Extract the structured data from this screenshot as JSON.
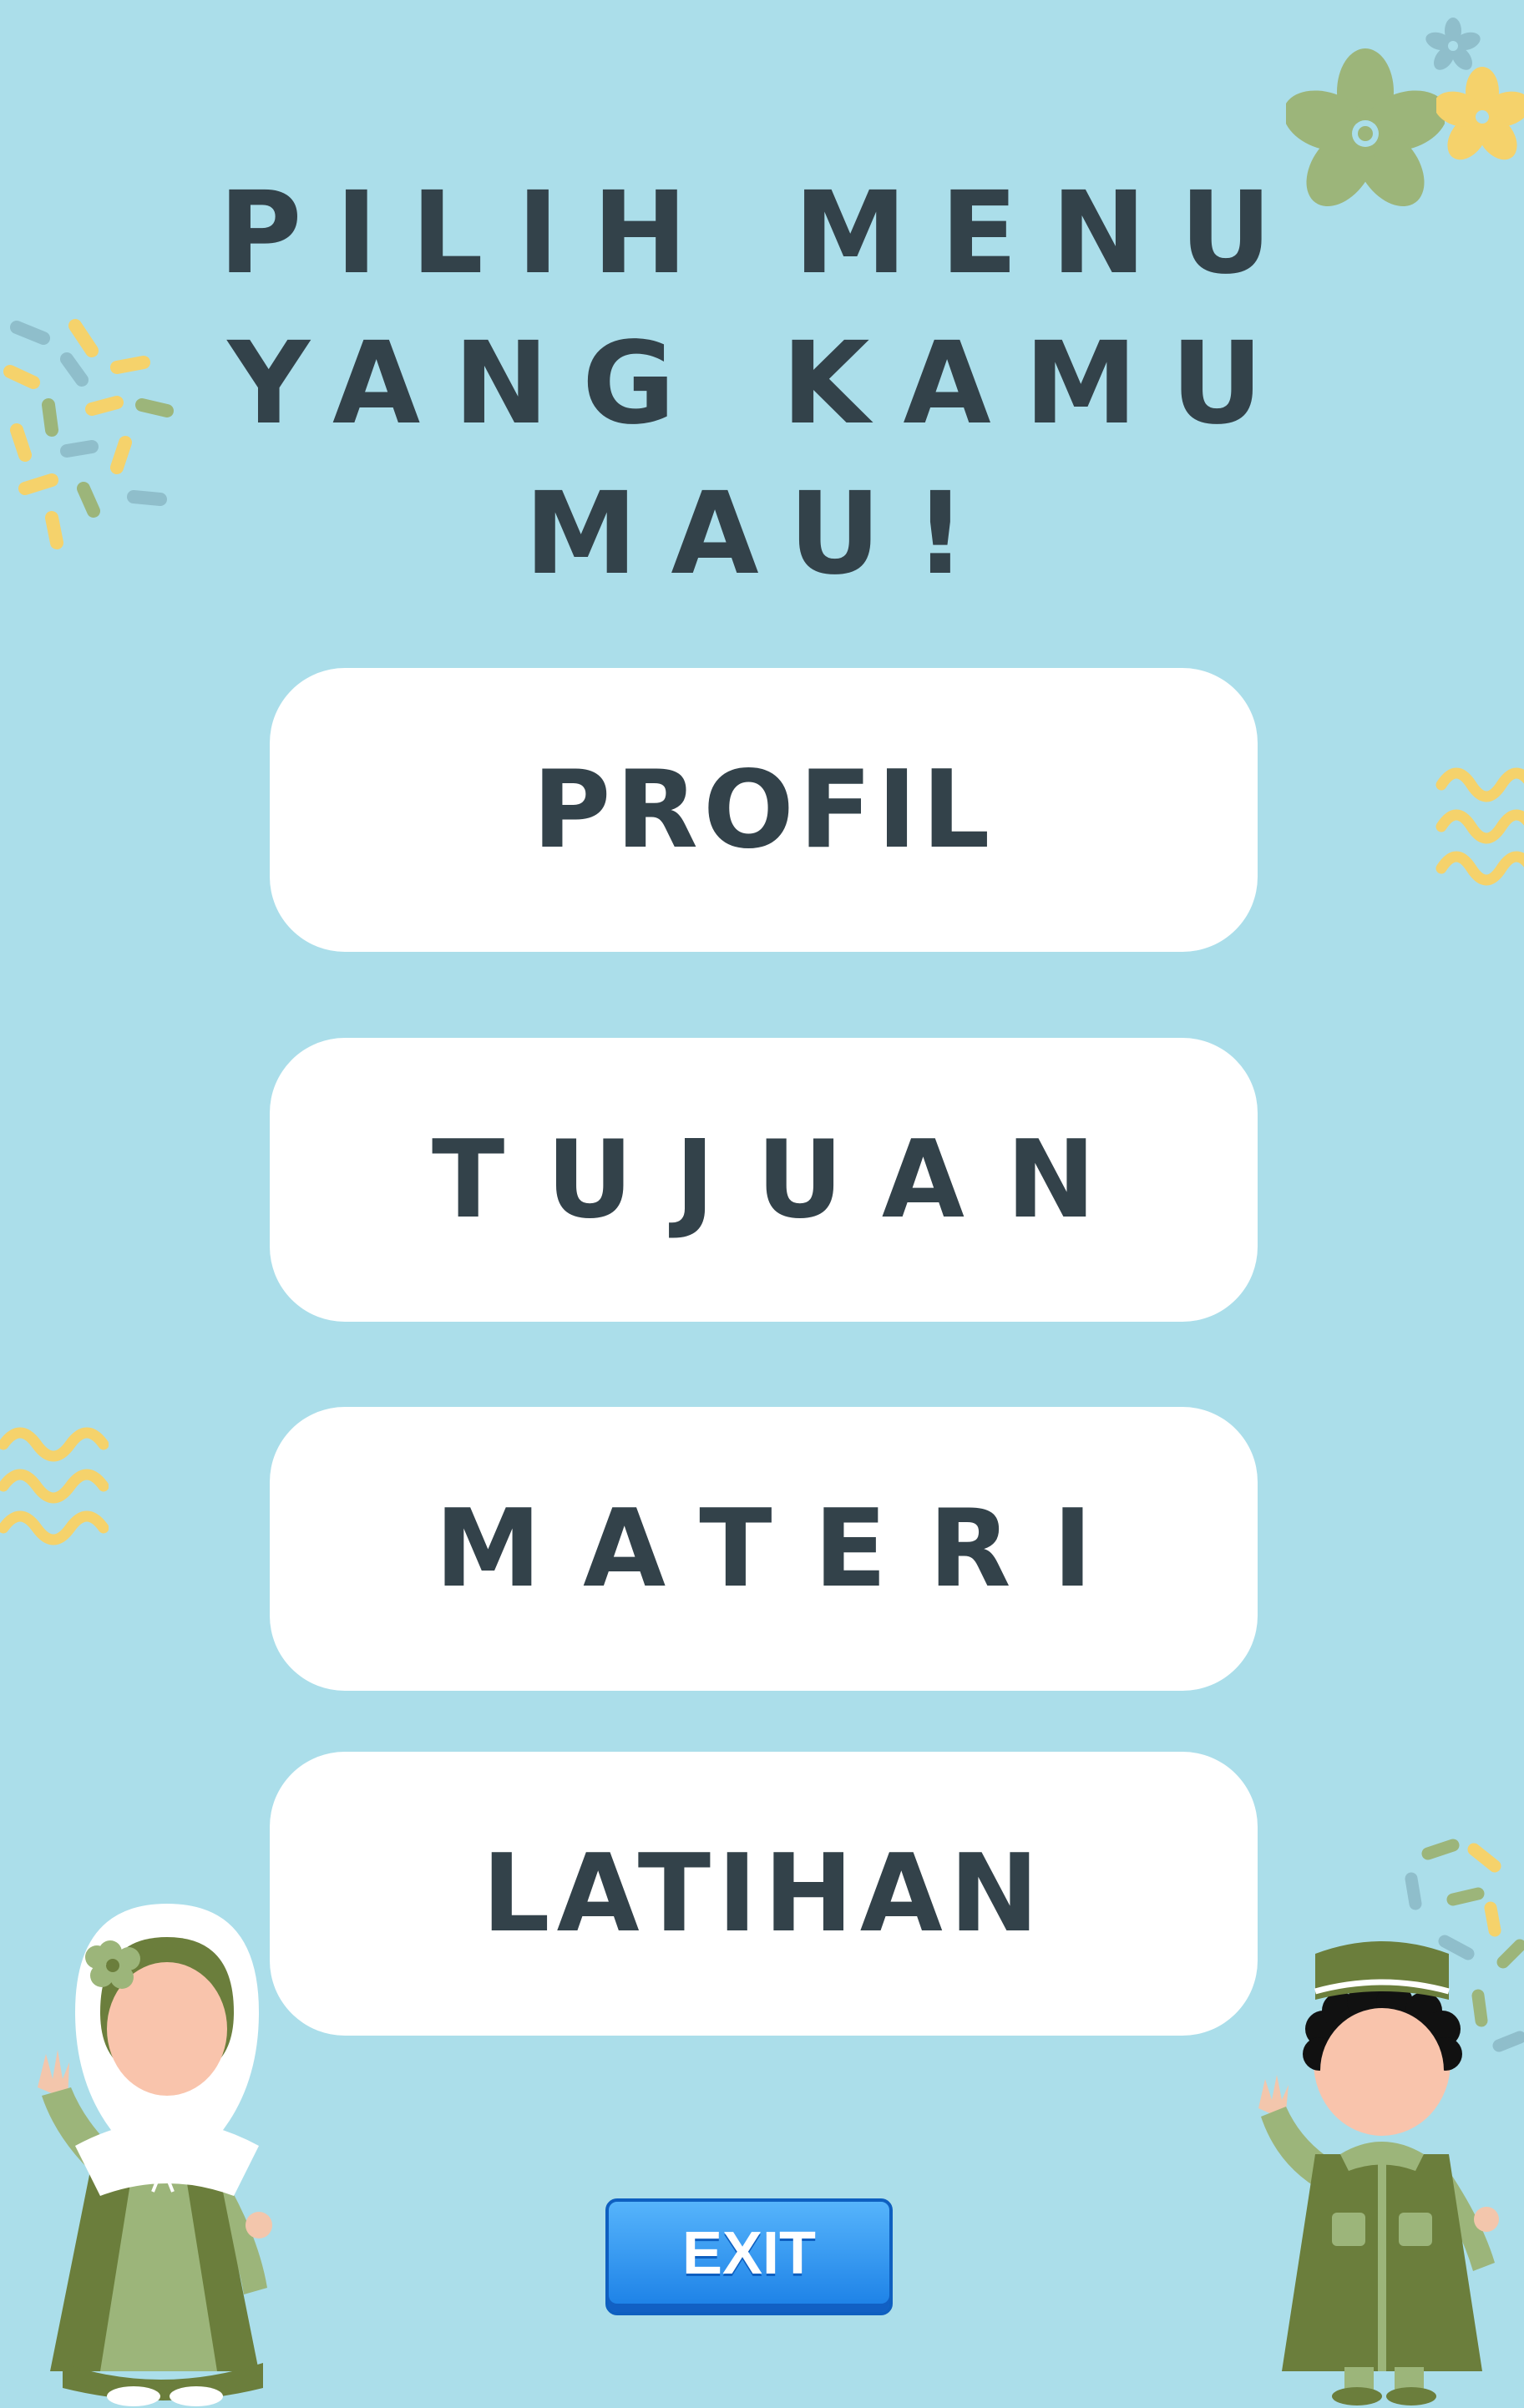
{
  "title": {
    "line1": "PILIH MENU",
    "line2": "YANG KAMU",
    "line3": "MAU!"
  },
  "menu": [
    {
      "label": "PROFIL"
    },
    {
      "label": "TUJUAN"
    },
    {
      "label": "MATERI"
    },
    {
      "label": "LATIHAN"
    }
  ],
  "exit": {
    "label": "EXIT"
  },
  "colors": {
    "background": "#abdeea",
    "text": "#33424a",
    "button": "#ffffff",
    "exit": "#2a8ff0",
    "green": "#6b7e3c",
    "yellow": "#f5d26b"
  },
  "icons": [
    "flower-icon",
    "confetti-icon",
    "wave-icon",
    "girl-character-icon",
    "boy-character-icon"
  ]
}
